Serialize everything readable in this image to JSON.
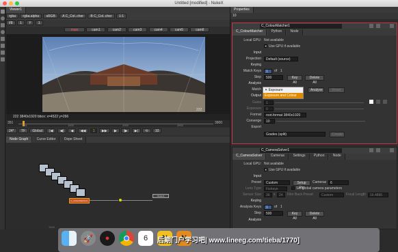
{
  "window": {
    "title": "Untitled [modified] - NukeX"
  },
  "viewer": {
    "tab": "Viewer1",
    "channels": "rgba",
    "alpha": "rgba.alpha",
    "colorspace": "sRGB",
    "input_a": "A C_Col..cher",
    "input_b": "B C_Col..cher",
    "zoom": "1:1",
    "proxy_mode": "f/8",
    "frame": "1",
    "y_label": "Y",
    "value": "1",
    "cams": [
      "main",
      "cam1",
      "cam2",
      "cam3",
      "cam4",
      "cam5",
      "cam6"
    ],
    "info": "222  3840x1920  bbox: x=4522 y=266",
    "pixel_count": "222",
    "start_frame": "351",
    "end_frame": "3900",
    "ticks": [
      "351",
      "1000",
      "2000",
      "2900",
      "3900"
    ],
    "fps": "24*",
    "tf": "TF",
    "global": "Global",
    "current_frame": "1",
    "step": "10"
  },
  "nodegraph": {
    "tabs": [
      "Node Graph",
      "Curve Editor",
      "Dope Sheet"
    ],
    "node_label": "C_ColourMatcher1",
    "viewer_node": "Viewer1",
    "frame_counter": "1543"
  },
  "properties": {
    "tab": "Properties",
    "count": "10",
    "cm": {
      "name": "C_ColourMatcher1",
      "tabs": [
        "C_ColourMatcher",
        "Python",
        "Node"
      ],
      "local_gpu_label": "Local GPU:",
      "local_gpu_value": "Not available",
      "use_gpu": "Use GPU if available",
      "input_header": "Input",
      "projection_label": "Projection",
      "projection_value": "Default (source)",
      "keying_header": "Keying",
      "match_keys_label": "Match Keys",
      "match_keys_value": "1",
      "of_label": "of",
      "of_value": "1",
      "step_label": "Step",
      "step_value": "500",
      "key_all": "Key All",
      "delete_all": "Delete All",
      "analysis_header": "Analysis",
      "match_label": "Match",
      "analyse": "Analyse",
      "reset": "Reset",
      "match_options": [
        "Exposure",
        "Exposure and Colour"
      ],
      "output_label": "Output",
      "gains_label": "Gains",
      "gains_value": "1",
      "exposure_label": "Exposure",
      "exposure_value": "0",
      "format_label": "Format",
      "format_value": "root.format 3840x1920",
      "converge_label": "Converge",
      "converge_value": "10",
      "export_label": "Export",
      "export_value": "Grades (split)",
      "create": "Create"
    },
    "cs": {
      "name": "C_CameraSolver1",
      "tabs": [
        "C_CameraSolver",
        "Cameras",
        "Settings",
        "Python",
        "Node"
      ],
      "local_gpu_label": "Local GPU:",
      "local_gpu_value": "Not available",
      "use_gpu": "Use GPU if available",
      "input_header": "Input",
      "preset_label": "Preset",
      "preset_value": "Custom",
      "setup_rig": "Setup Rig",
      "cameras_label": "Cameras",
      "cameras_value": "6",
      "lens_type_label": "Lens Type",
      "lens_type_value": "Fisheye",
      "global_params": "Set global camera parameters",
      "sensor_size_label": "Sensor Size",
      "sensor_w": "36",
      "sensor_x": "x",
      "sensor_h": "24",
      "film_back_label": "Film Back Preset",
      "film_back_value": "Custom",
      "focal_label": "Focal Length",
      "focal_value": "16.4895",
      "keying_header": "Keying",
      "analysis_keys_label": "Analysis Keys",
      "analysis_keys_value": "1",
      "of_label": "of",
      "of_value": "1",
      "step_label": "Step",
      "step_value": "500",
      "key_all": "Key All",
      "delete_all": "Delete All",
      "analysis_header": "Analysis"
    }
  },
  "dock": {
    "items": [
      "finder",
      "launchpad",
      "davinci",
      "chrome",
      "calendar",
      "nuke",
      "nuke2"
    ],
    "calendar_day": "6",
    "watermark": "后期门户学习吧| www.lineeg.com/tieba/1770]"
  },
  "colors": {
    "accent": "#e07a1a",
    "selected": "#ff8c00",
    "nodegraph_bg": "#2c2c2c"
  }
}
